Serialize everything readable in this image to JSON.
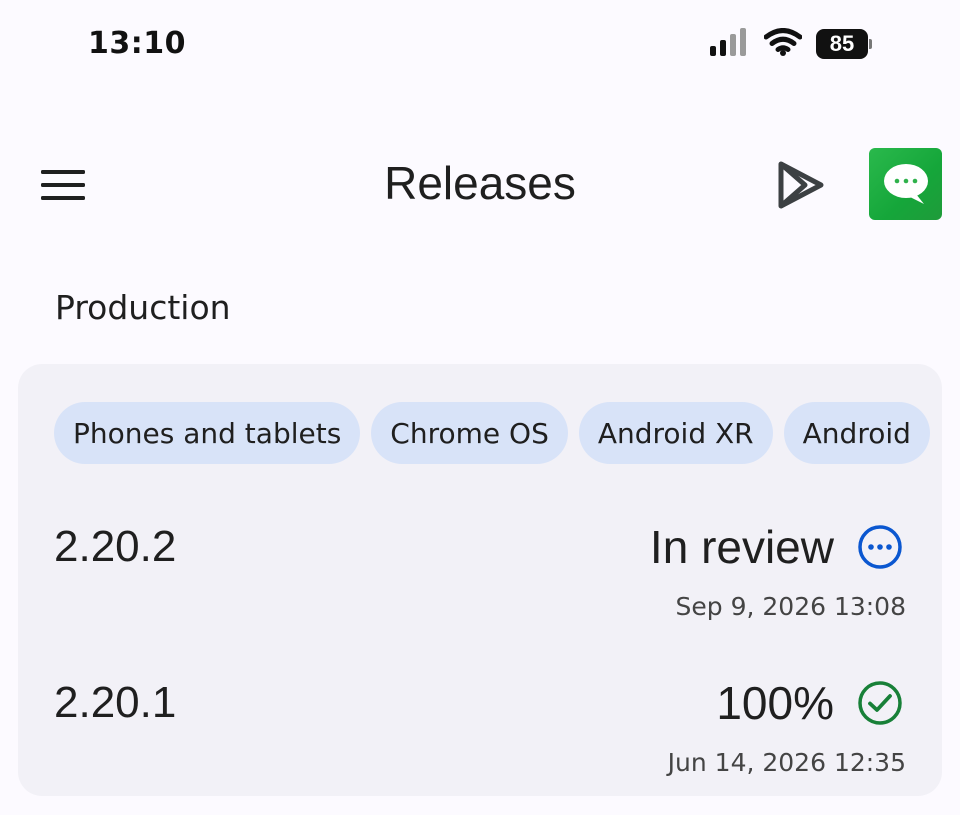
{
  "status_bar": {
    "time": "13:10",
    "battery": "85",
    "icons": [
      "cellular-signal-icon",
      "wifi-icon",
      "battery-icon"
    ]
  },
  "app_bar": {
    "title": "Releases",
    "icons": [
      "menu-icon",
      "play-console-icon",
      "chat-app-icon"
    ]
  },
  "section": {
    "title": "Production"
  },
  "chips": [
    {
      "label": "Phones and tablets"
    },
    {
      "label": "Chrome OS"
    },
    {
      "label": "Android XR"
    },
    {
      "label": "Android"
    }
  ],
  "releases": [
    {
      "version": "2.20.2",
      "status": "In review",
      "status_icon": "in-review-icon",
      "date": "Sep 9, 2026 13:08"
    },
    {
      "version": "2.20.1",
      "status": "100%",
      "status_icon": "check-circle-icon",
      "date": "Jun 14, 2026 12:35"
    }
  ],
  "colors": {
    "background": "#fcfaff",
    "card": "#f2f1f7",
    "chip": "#d8e3f8",
    "in_review": "#0b57d0",
    "success": "#188038",
    "avatar": "#1fae44"
  }
}
